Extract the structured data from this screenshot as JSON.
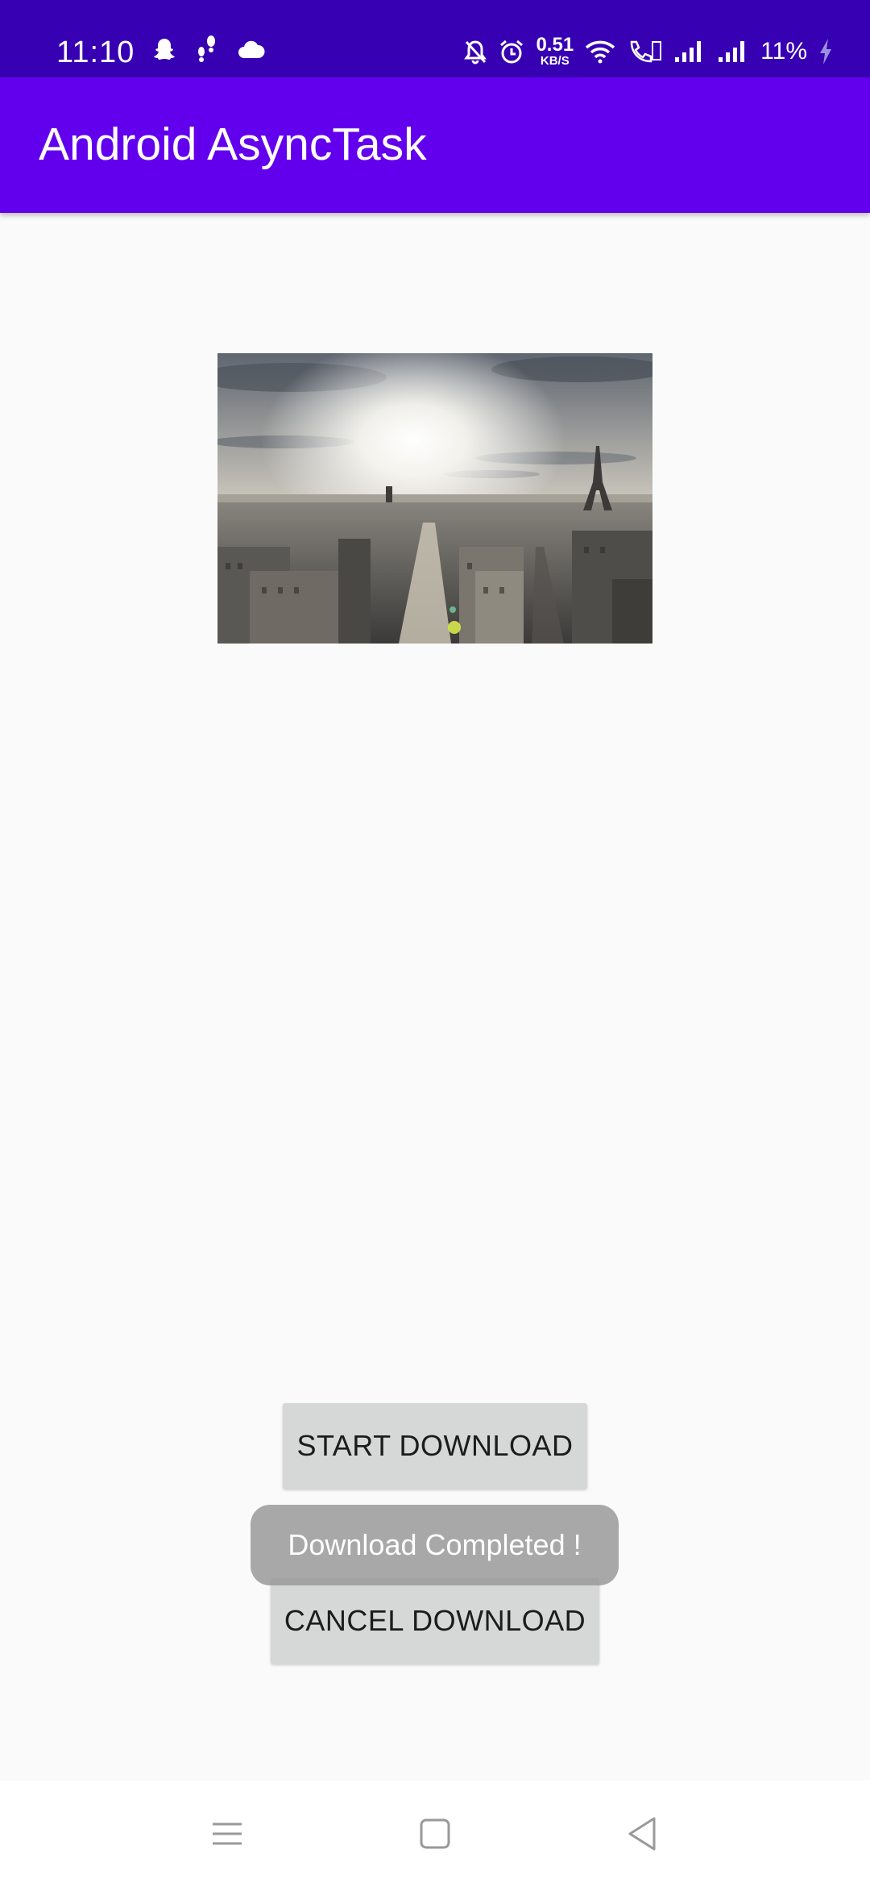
{
  "status_bar": {
    "time": "11:10",
    "net_speed_value": "0.51",
    "net_speed_unit": "KB/S",
    "battery": "11%",
    "left_icons": [
      "snapchat-icon",
      "steps-icon",
      "cloud-icon"
    ],
    "right_icons": [
      "bell-off-icon",
      "alarm-icon",
      "wifi-icon",
      "volte-call-icon",
      "signal-icon",
      "signal-icon",
      "charging-icon"
    ]
  },
  "app_bar": {
    "title": "Android AsyncTask"
  },
  "main": {
    "image": "city-skyline-eiffel-tower-photo",
    "start_button": "START DOWNLOAD",
    "cancel_button": "CANCEL DOWNLOAD",
    "toast": "Download Completed !"
  },
  "nav_bar": {
    "icons": [
      "menu-icon",
      "home-icon",
      "back-icon"
    ]
  },
  "colors": {
    "status_bar": "#3700b3",
    "app_bar": "#6200ee",
    "background": "#fafafa",
    "button": "#d6d7d7"
  }
}
